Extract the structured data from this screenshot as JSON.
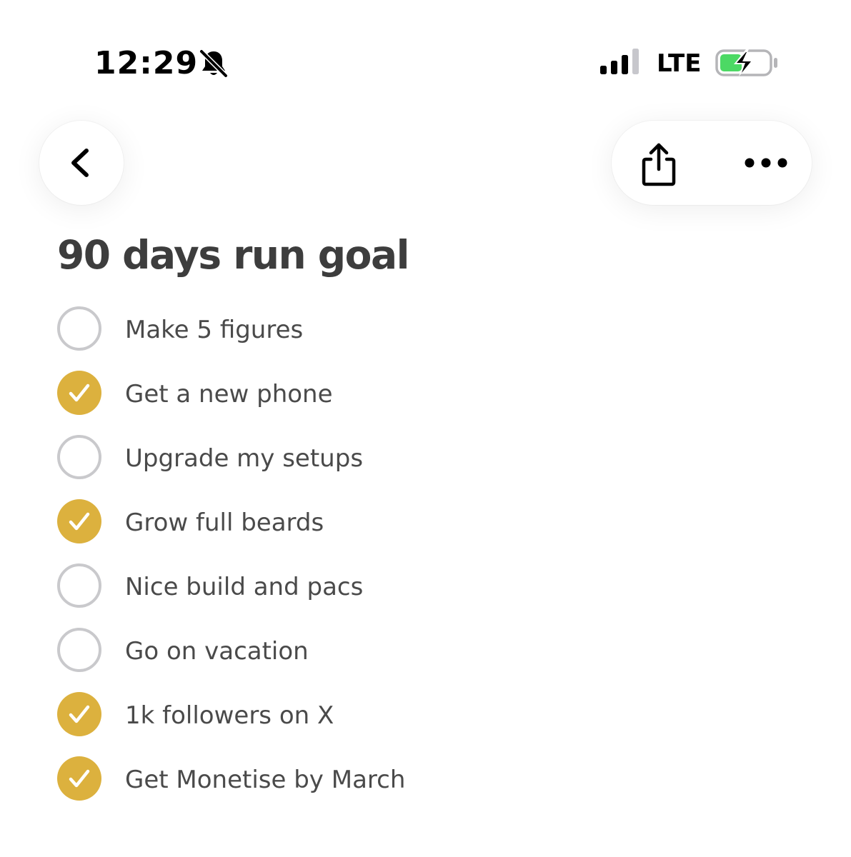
{
  "status_bar": {
    "time": "12:29",
    "network": "LTE",
    "icons": [
      "bell-slash-icon",
      "cellular-signal-icon",
      "battery-charging-icon"
    ],
    "signal_bars_active": 3,
    "signal_bars_total": 4,
    "battery_level": 0.45,
    "battery_color": "#4cd964"
  },
  "nav": {
    "back_icon": "chevron-left-icon",
    "share_icon": "share-icon",
    "more_icon": "ellipsis-icon"
  },
  "list": {
    "title": "90 days run goal",
    "check_color": "#dcb13e",
    "items": [
      {
        "label": "Make 5 figures",
        "done": false
      },
      {
        "label": "Get a new phone",
        "done": true
      },
      {
        "label": "Upgrade my setups",
        "done": false
      },
      {
        "label": "Grow full beards",
        "done": true
      },
      {
        "label": "Nice build and pacs",
        "done": false
      },
      {
        "label": "Go on vacation",
        "done": false
      },
      {
        "label": "1k followers on X",
        "done": true
      },
      {
        "label": "Get Monetise by March",
        "done": true
      }
    ]
  }
}
